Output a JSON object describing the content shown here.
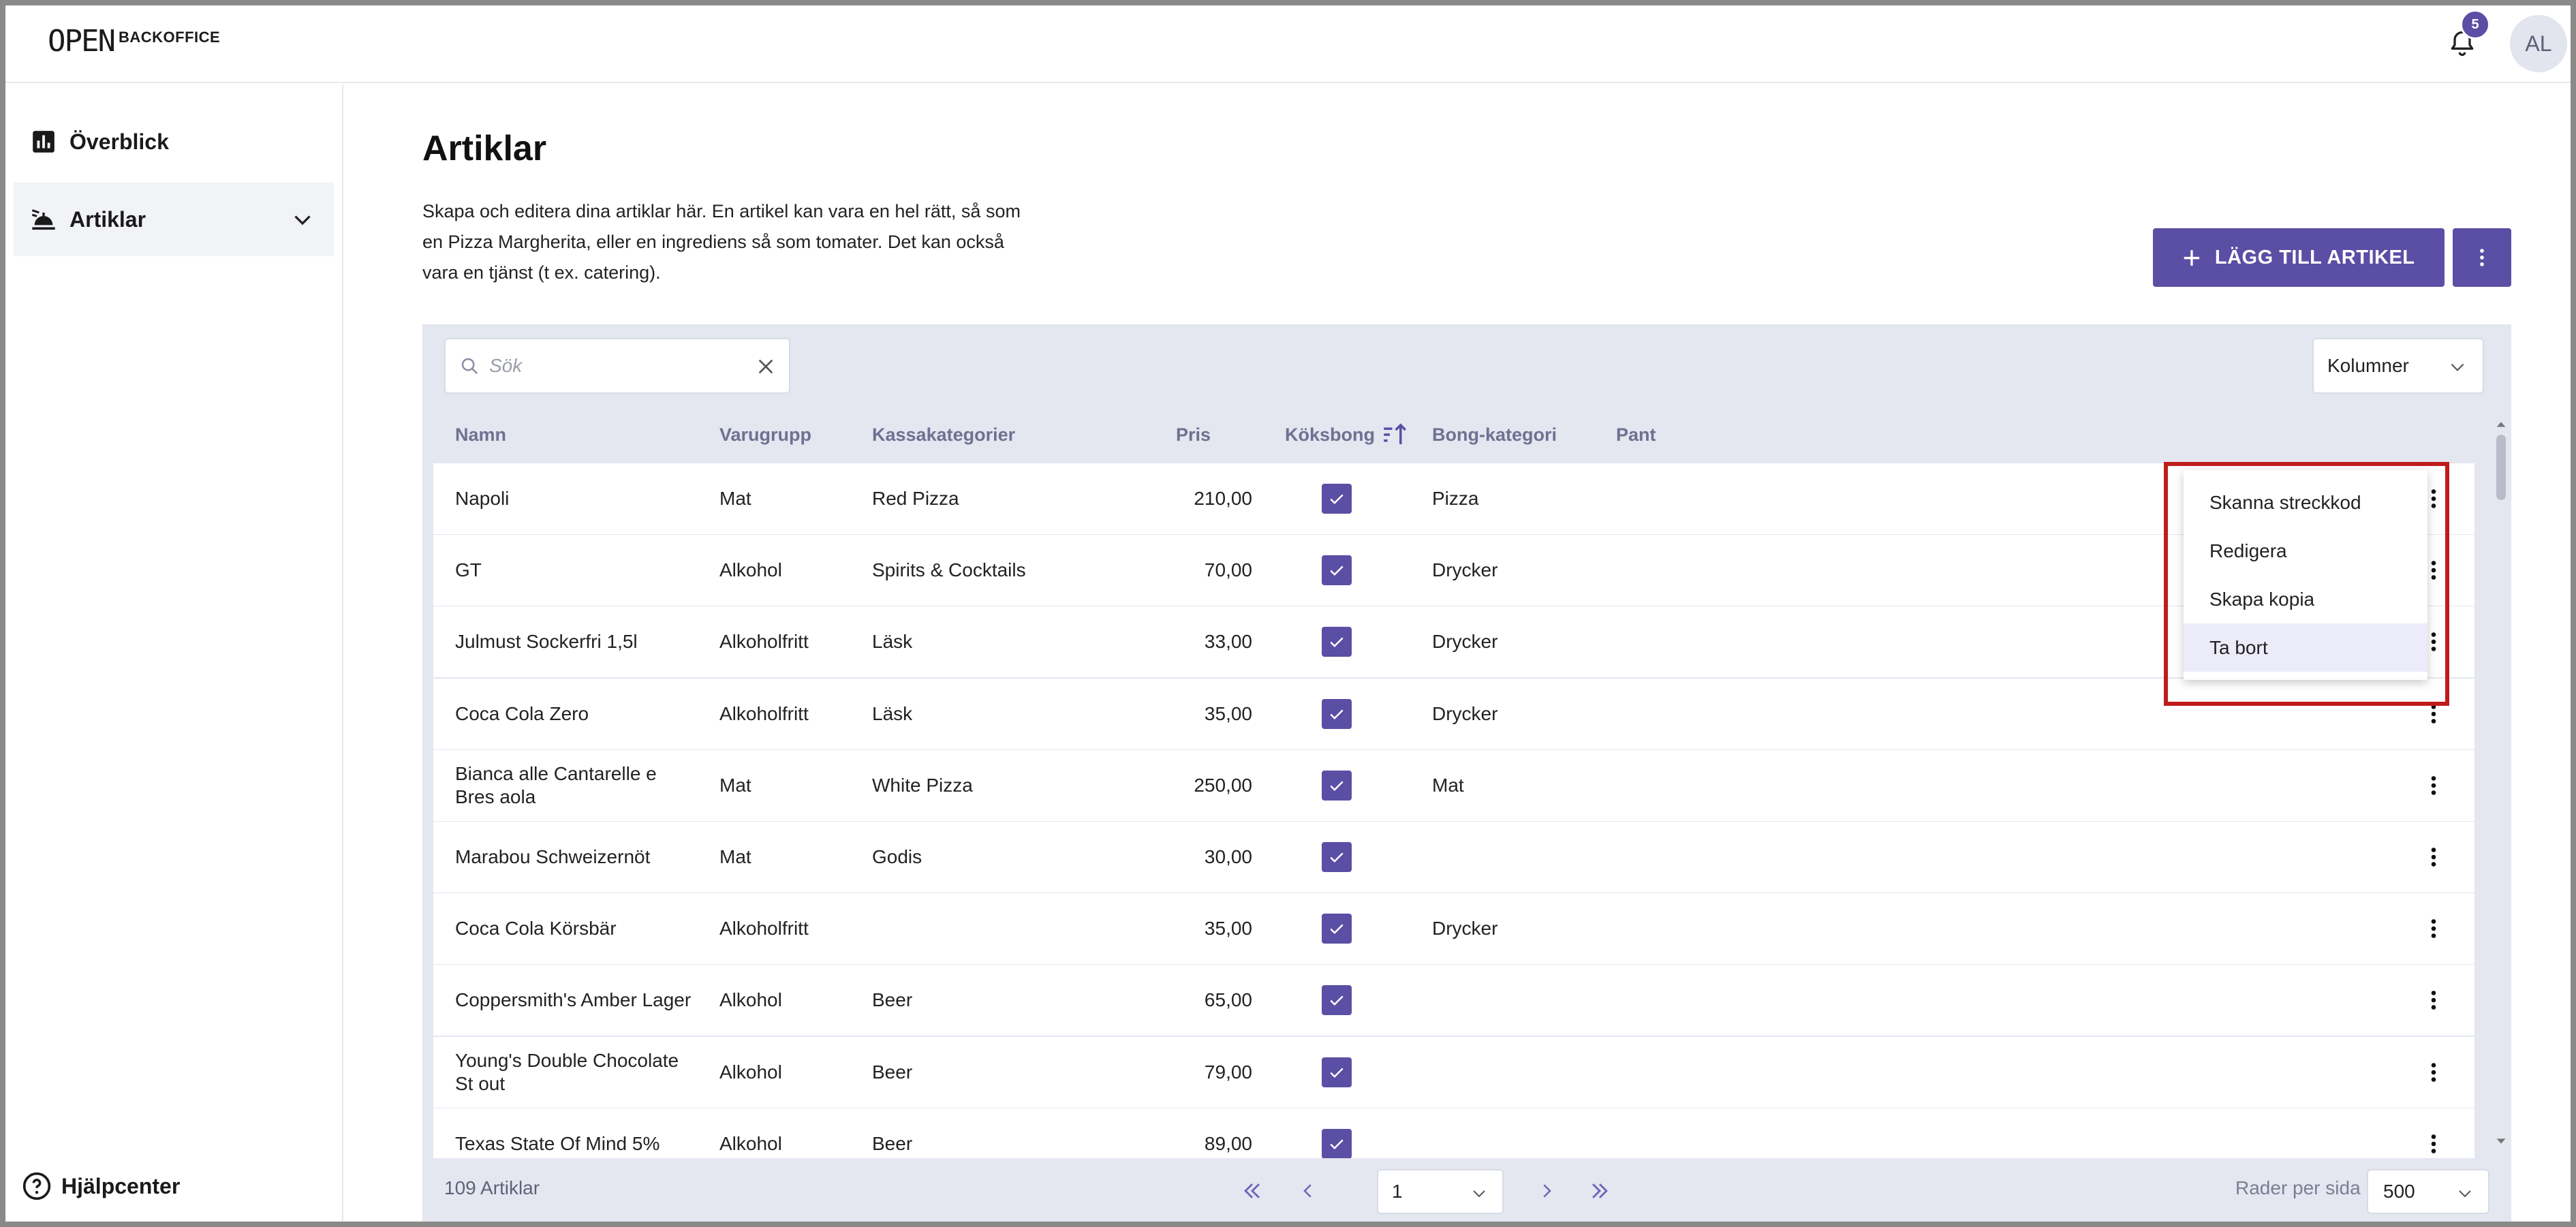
{
  "header": {
    "logo_mark": "OPEN",
    "logo_text": "BACKOFFICE",
    "notification_count": "5",
    "avatar_initials": "AL"
  },
  "sidebar": {
    "items": [
      {
        "label": "Överblick",
        "icon": "bar-chart-icon"
      },
      {
        "label": "Artiklar",
        "icon": "food-tray-icon",
        "active": true
      }
    ],
    "help_label": "Hjälpcenter"
  },
  "main": {
    "title": "Artiklar",
    "description": "Skapa och editera dina artiklar här. En artikel kan vara en hel rätt, så som en Pizza Margherita, eller en ingrediens så som tomater. Det kan också vara en tjänst (t ex. catering).",
    "add_button_label": "LÄGG TILL ARTIKEL"
  },
  "table": {
    "search_placeholder": "Sök",
    "columns_button_label": "Kolumner",
    "headers": {
      "name": "Namn",
      "group": "Varugrupp",
      "pos_categories": "Kassakategorier",
      "price": "Pris",
      "kitchen_ticket": "Köksbong",
      "ticket_category": "Bong-kategori",
      "deposit": "Pant"
    },
    "rows": [
      {
        "name": "Napoli",
        "group": "Mat",
        "category": "Red Pizza",
        "price": "210,00",
        "kitchen": true,
        "ticket_category": "Pizza"
      },
      {
        "name": "GT",
        "group": "Alkohol",
        "category": "Spirits & Cocktails",
        "price": "70,00",
        "kitchen": true,
        "ticket_category": "Drycker"
      },
      {
        "name": "Julmust Sockerfri 1,5l",
        "group": "Alkoholfritt",
        "category": "Läsk",
        "price": "33,00",
        "kitchen": true,
        "ticket_category": "Drycker"
      },
      {
        "name": "Coca Cola Zero",
        "group": "Alkoholfritt",
        "category": "Läsk",
        "price": "35,00",
        "kitchen": true,
        "ticket_category": "Drycker"
      },
      {
        "name": "Bianca alle Cantarelle e Bres aola",
        "group": "Mat",
        "category": "White Pizza",
        "price": "250,00",
        "kitchen": true,
        "ticket_category": "Mat"
      },
      {
        "name": "Marabou Schweizernöt",
        "group": "Mat",
        "category": "Godis",
        "price": "30,00",
        "kitchen": true,
        "ticket_category": ""
      },
      {
        "name": "Coca Cola Körsbär",
        "group": "Alkoholfritt",
        "category": "",
        "price": "35,00",
        "kitchen": true,
        "ticket_category": "Drycker"
      },
      {
        "name": "Coppersmith's Amber Lager",
        "group": "Alkohol",
        "category": "Beer",
        "price": "65,00",
        "kitchen": true,
        "ticket_category": ""
      },
      {
        "name": "Young's Double Chocolate St out",
        "group": "Alkohol",
        "category": "Beer",
        "price": "79,00",
        "kitchen": true,
        "ticket_category": ""
      },
      {
        "name": "Texas State Of Mind 5%",
        "group": "Alkohol",
        "category": "Beer",
        "price": "89,00",
        "kitchen": true,
        "ticket_category": ""
      }
    ],
    "footer": {
      "count_label": "109 Artiklar",
      "current_page": "1",
      "rows_per_page_label": "Rader per sida",
      "rows_per_page": "500"
    }
  },
  "context_menu": {
    "items": [
      "Skanna streckkod",
      "Redigera",
      "Skapa kopia",
      "Ta bort"
    ],
    "hovered_index": 3
  },
  "colors": {
    "accent": "#5b4ea5",
    "highlight": "#c01c1c",
    "table_bg": "#e4e6f0",
    "header_text": "#6d7292"
  }
}
